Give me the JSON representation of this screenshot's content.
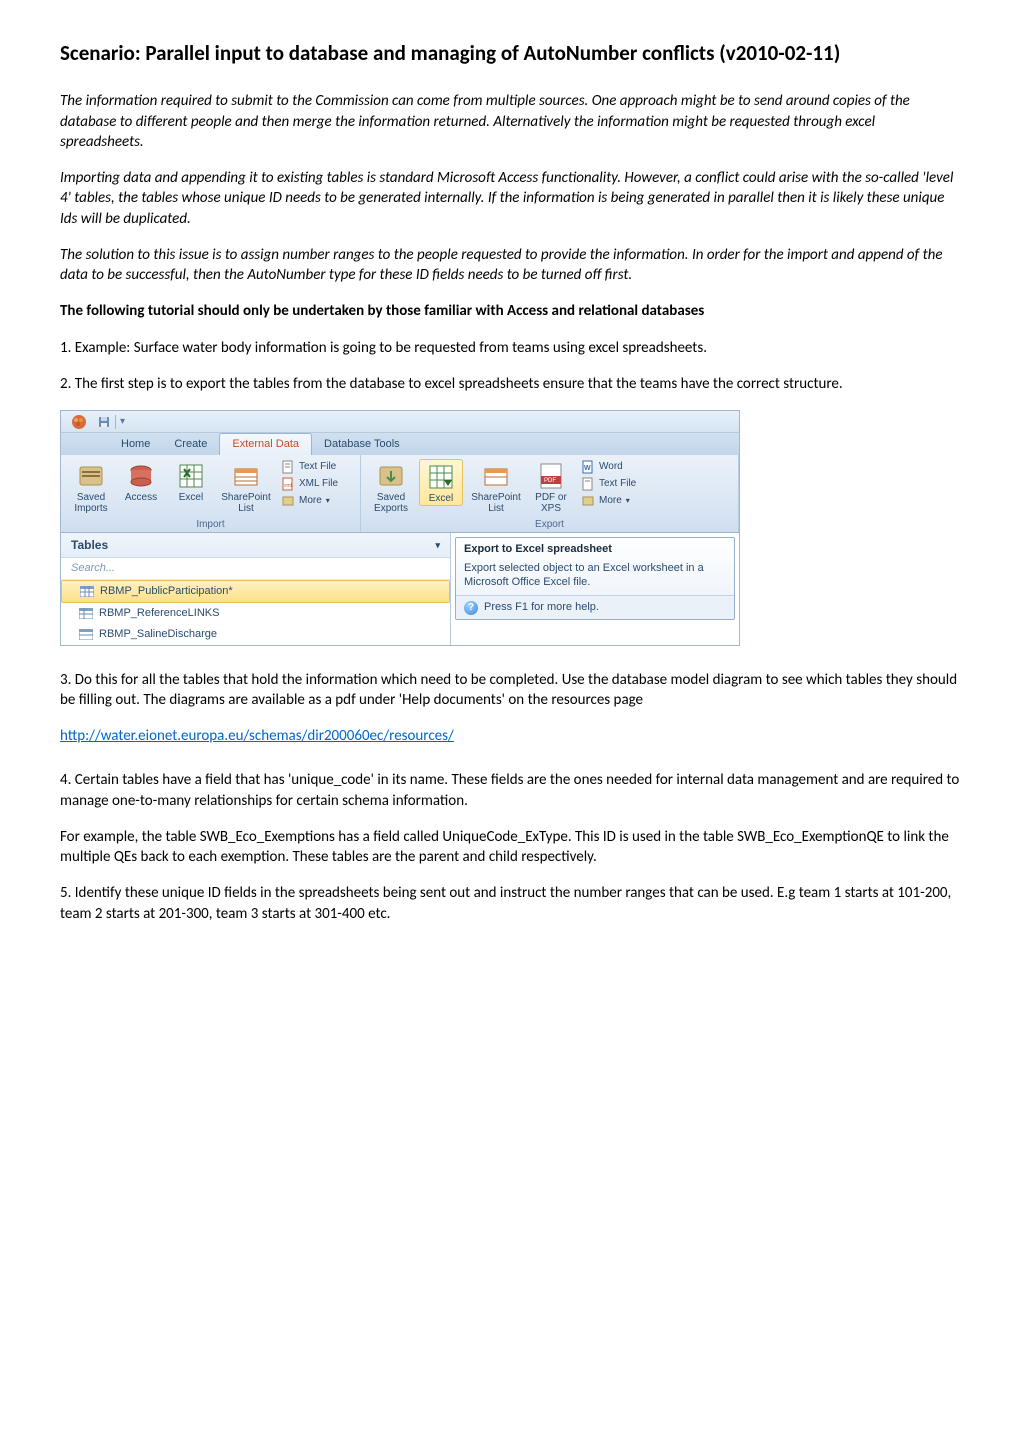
{
  "title": "Scenario: Parallel input to database and managing of AutoNumber conflicts (v2010-02-11)",
  "para1": "The information required to submit to the Commission can come from multiple sources. One approach might be to send around copies of the database to different people and then merge the information returned. Alternatively the information might be requested through excel spreadsheets.",
  "para2": "Importing data and appending it to existing tables is standard Microsoft Access functionality. However, a conflict could arise with the so-called 'level 4' tables, the tables whose unique ID needs to be generated internally. If the information is being generated in parallel then it is likely these unique Ids will be duplicated.",
  "para3": "The solution to this issue is to assign number ranges to the people requested to provide the information. In order for the import and append of the data to be successful, then the AutoNumber type for these ID fields needs to be turned off first.",
  "para4": "The following tutorial should only be undertaken by those familiar with Access and relational databases",
  "step1": "1. Example: Surface water body information is going to be requested from teams using excel spreadsheets.",
  "step2": "2. The first step is to export the tables from the database to excel spreadsheets ensure that the teams have the correct structure.",
  "step3": "3. Do this for all the tables that hold the information which need to be completed.  Use the database model diagram to see which tables they should be filling out. The diagrams are available as a pdf under 'Help documents' on the resources page",
  "link": "http://water.eionet.europa.eu/schemas/dir200060ec/resources/",
  "step4a": "4. Certain tables have a field that has 'unique_code' in its name. These fields are the ones needed for internal data management and are required to manage one-to-many relationships for certain schema information.",
  "step4b": "For example, the table SWB_Eco_Exemptions has a field called UniqueCode_ExType. This ID is used in the table SWB_Eco_ExemptionQE to link the multiple QEs back to each exemption. These tables are the parent and child respectively.",
  "step5": "5. Identify these unique ID fields in the spreadsheets being sent out and instruct the number ranges that can be used. E.g team 1 starts at 101-200, team 2 starts at 201-300, team 3 starts at 301-400 etc.",
  "ribbon": {
    "tabs": {
      "home": "Home",
      "create": "Create",
      "external": "External Data",
      "database": "Database Tools"
    },
    "import": {
      "saved": "Saved Imports",
      "access": "Access",
      "excel": "Excel",
      "sharepoint": "SharePoint List",
      "text": "Text File",
      "xml": "XML File",
      "more": "More",
      "group": "Import"
    },
    "export": {
      "saved": "Saved Exports",
      "excel": "Excel",
      "sharepoint": "SharePoint List",
      "pdf": "PDF or XPS",
      "word": "Word",
      "text": "Text File",
      "more": "More",
      "group": "Export"
    }
  },
  "tables_pane": {
    "header": "Tables",
    "search": "Search...",
    "items": {
      "0": "RBMP_PublicParticipation*",
      "1": "RBMP_ReferenceLINKS",
      "2": "RBMP_SalineDischarge"
    }
  },
  "tooltip": {
    "title": "Export to Excel spreadsheet",
    "body": "Export selected object to an Excel worksheet in a Microsoft Office Excel file.",
    "help": "Press F1 for more help."
  }
}
